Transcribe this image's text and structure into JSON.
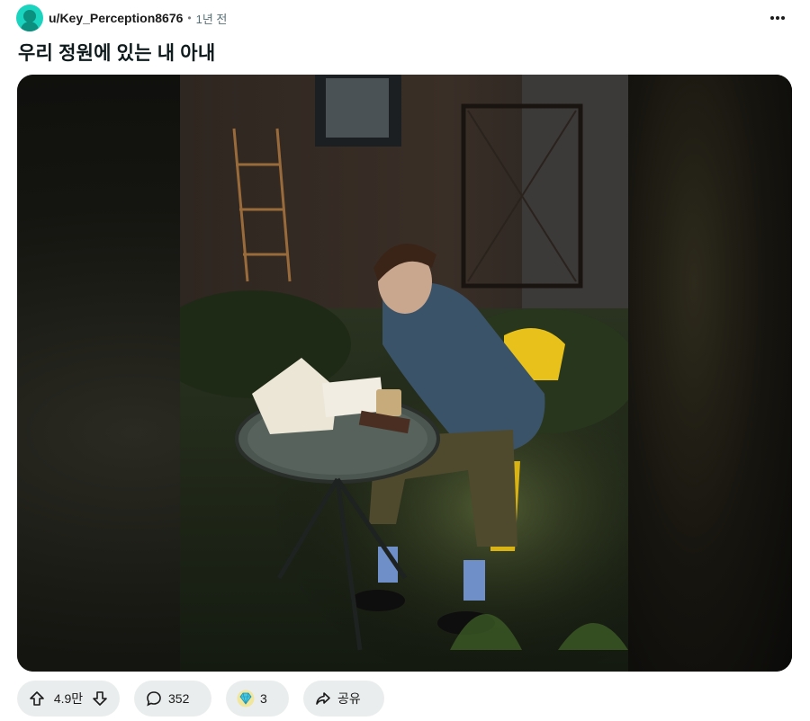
{
  "post": {
    "author": "u/Key_Perception8676",
    "separator": "•",
    "time": "1년 전",
    "title": "우리 정원에 있는 내 아내"
  },
  "media": {
    "alt": "photo: woman seated at a glass garden table on a yellow chair, in the sun"
  },
  "actions": {
    "votes": "4.9만",
    "comments": "352",
    "awards": "3",
    "share": "공유"
  },
  "icons": {
    "avatar": "snoo-avatar-icon",
    "more": "more-horizontal-icon",
    "upvote": "upvote-arrow-icon",
    "downvote": "downvote-arrow-icon",
    "comment": "comment-bubble-icon",
    "award": "award-gem-icon",
    "share": "share-arrow-icon"
  },
  "colors": {
    "avatar_bg": "#1ad4c0",
    "pill_bg": "#eaeded",
    "chair": "#e8c21a",
    "jacket": "#3b5368"
  }
}
